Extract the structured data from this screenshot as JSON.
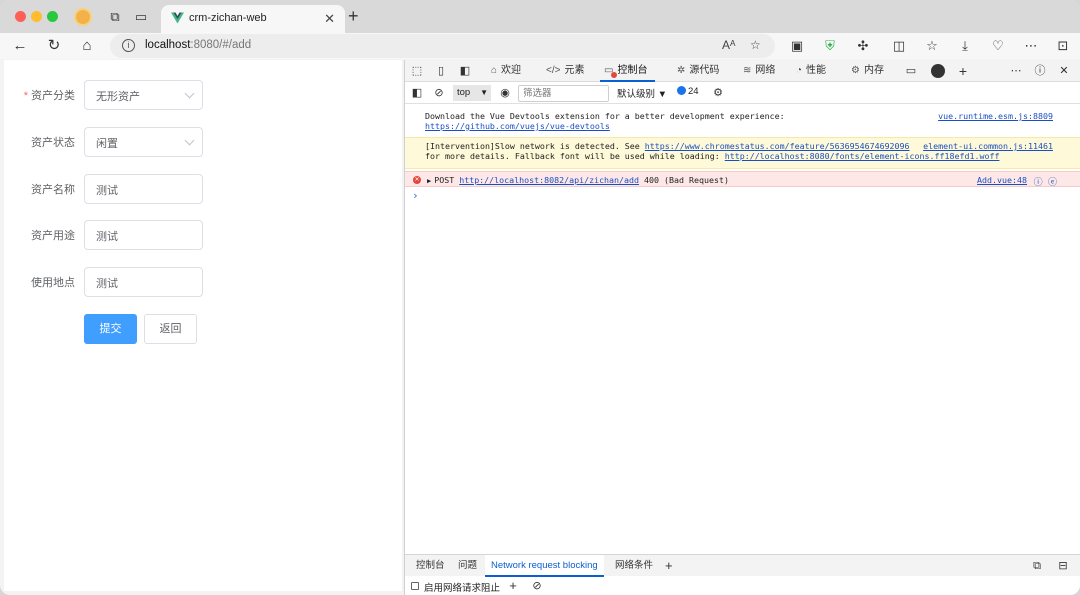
{
  "browser": {
    "tab_title": "crm-zichan-web",
    "tab_close": "✕",
    "new_tab": "+",
    "url_host": "localhost",
    "url_rest": ":8080/#/add",
    "read_aloud": "Aᴬ"
  },
  "form": {
    "fields": [
      {
        "label": "资产分类",
        "value": "无形资产",
        "required": true,
        "type": "select"
      },
      {
        "label": "资产状态",
        "value": "闲置",
        "required": false,
        "type": "select"
      },
      {
        "label": "资产名称",
        "value": "测试",
        "required": false,
        "type": "input"
      },
      {
        "label": "资产用途",
        "value": "测试",
        "required": false,
        "type": "input"
      },
      {
        "label": "使用地点",
        "value": "测试",
        "required": false,
        "type": "input"
      }
    ],
    "required_mark": "*",
    "submit_label": "提交",
    "back_label": "返回",
    "primary_color": "#409eff"
  },
  "devtools": {
    "tabs": [
      {
        "label": "欢迎",
        "glyph": "⌂"
      },
      {
        "label": "元素",
        "glyph": "</>"
      },
      {
        "label": "控制台",
        "glyph": "▭",
        "active": true
      },
      {
        "label": "源代码",
        "glyph": "✲"
      },
      {
        "label": "网络",
        "glyph": "≋"
      },
      {
        "label": "性能",
        "glyph": "◔"
      },
      {
        "label": "内存",
        "glyph": "⚙"
      }
    ],
    "context": "top",
    "filter_placeholder": "筛选器",
    "level": "默认级别",
    "issues_count": "24",
    "console": {
      "info_line1": "Download the Vue Devtools extension for a better development experience:",
      "info_link": "https://github.com/vuejs/vue-devtools",
      "info_src": "vue.runtime.esm.js:8809",
      "warn_text1": "[Intervention]Slow network is detected. See ",
      "warn_link1": "https://www.chromestatus.com/feature/5636954674692096",
      "warn_src": "element-ui.common.js:11461",
      "warn_text2": "for more details. Fallback font will be used while loading: ",
      "warn_link2": "http://localhost:8080/fonts/element-icons.ff18efd1.woff",
      "err_method": "POST ",
      "err_link": "http://localhost:8082/api/zichan/add",
      "err_status": " 400 (Bad Request)",
      "err_src": "Add.vue:48",
      "prompt": "›"
    },
    "drawer_tabs": [
      {
        "label": "控制台"
      },
      {
        "label": "问题"
      },
      {
        "label": "Network request blocking",
        "active": true
      },
      {
        "label": "网络条件"
      }
    ],
    "drawer_add": "+",
    "drawer_checkbox_label": "启用网络请求阻止"
  }
}
